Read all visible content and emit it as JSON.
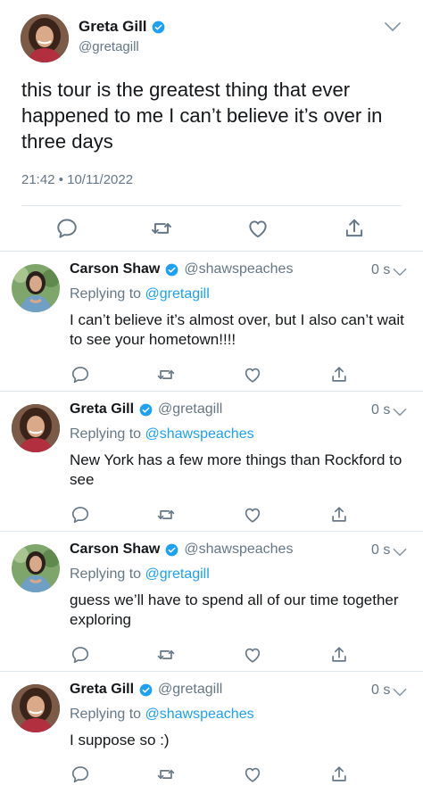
{
  "main_tweet": {
    "author_name": "Greta Gill",
    "author_handle": "@gretagill",
    "text": "this tour is the greatest thing that ever happened to me I can’t believe it’s over in three days",
    "timestamp": "21:42 • 10/11/2022"
  },
  "replies": [
    {
      "author_name": "Carson Shaw",
      "author_handle": "@shawspeaches",
      "time_ago": "0 s",
      "replying_prefix": "Replying to",
      "replying_to": "@gretagill",
      "text": "I can’t believe it’s almost over, but I also can’t wait to see your hometown!!!!"
    },
    {
      "author_name": "Greta Gill",
      "author_handle": "@gretagill",
      "time_ago": "0 s",
      "replying_prefix": "Replying to",
      "replying_to": "@shawspeaches",
      "text": "New York has a few more things than Rockford to see"
    },
    {
      "author_name": "Carson Shaw",
      "author_handle": "@shawspeaches",
      "time_ago": "0 s",
      "replying_prefix": "Replying to",
      "replying_to": "@gretagill",
      "text": "guess we’ll have to spend all of our time together exploring"
    },
    {
      "author_name": "Greta Gill",
      "author_handle": "@gretagill",
      "time_ago": "0 s",
      "replying_prefix": "Replying to",
      "replying_to": "@shawspeaches",
      "text": "I suppose so :)"
    }
  ],
  "colors": {
    "verified": "#1da1f2",
    "link": "#1da1f2",
    "secondary_text": "#657786",
    "icon": "#657786",
    "divider": "#e1e8ed"
  },
  "icons": [
    "verified-badge-icon",
    "chevron-down-icon",
    "reply-icon",
    "retweet-icon",
    "like-icon",
    "share-icon"
  ]
}
